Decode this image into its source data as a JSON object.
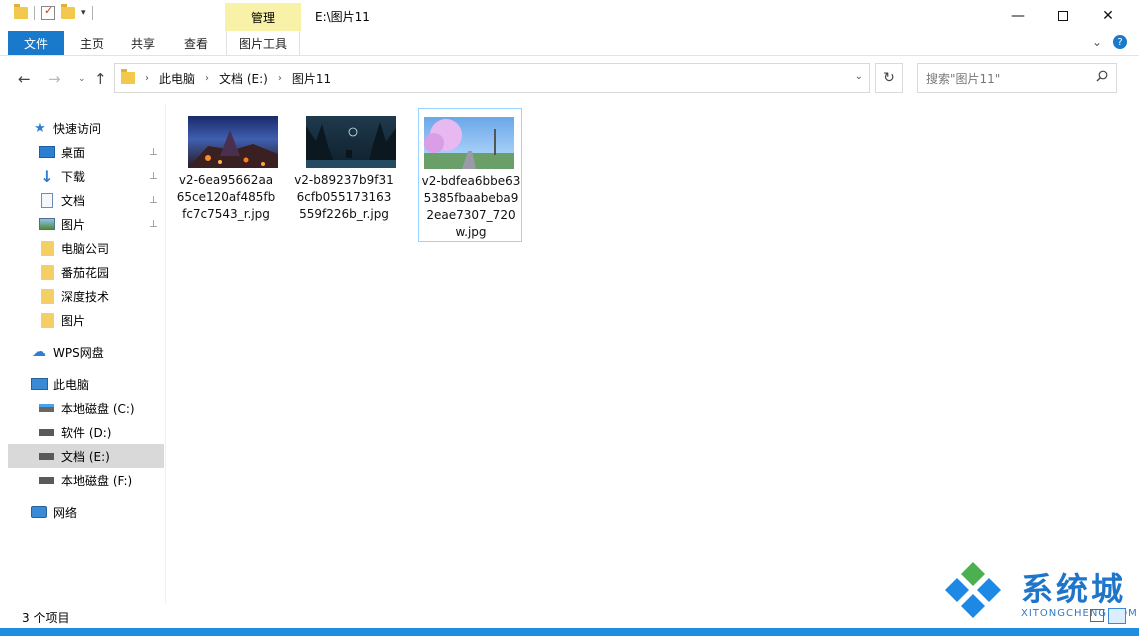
{
  "window": {
    "title": "E:\\图片11",
    "manage_tab": "管理",
    "controls": {
      "minimize": "—",
      "maximize": "",
      "close": "✕"
    }
  },
  "ribbon": {
    "tabs": [
      {
        "label": "文件"
      },
      {
        "label": "主页"
      },
      {
        "label": "共享"
      },
      {
        "label": "查看"
      },
      {
        "label": "图片工具"
      }
    ],
    "expand_glyph": "⌄",
    "help_glyph": "?"
  },
  "address": {
    "breadcrumbs": [
      "此电脑",
      "文档 (E:)",
      "图片11"
    ],
    "separator": "›",
    "search_placeholder": "搜索\"图片11\""
  },
  "sidebar": {
    "items": [
      {
        "label": "快速访问",
        "icon": "star-icon",
        "pinned": false
      },
      {
        "label": "桌面",
        "icon": "desktop-icon",
        "pinned": true
      },
      {
        "label": "下载",
        "icon": "download-icon",
        "pinned": true
      },
      {
        "label": "文档",
        "icon": "document-icon",
        "pinned": true
      },
      {
        "label": "图片",
        "icon": "picture-icon",
        "pinned": true
      },
      {
        "label": "电脑公司",
        "icon": "folder-icon",
        "pinned": false
      },
      {
        "label": "番茄花园",
        "icon": "folder-icon",
        "pinned": false
      },
      {
        "label": "深度技术",
        "icon": "folder-icon",
        "pinned": false
      },
      {
        "label": "图片",
        "icon": "folder-icon",
        "pinned": false
      },
      {
        "label": "WPS网盘",
        "icon": "cloud-icon",
        "pinned": false
      },
      {
        "label": "此电脑",
        "icon": "computer-icon",
        "pinned": false
      },
      {
        "label": "本地磁盘 (C:)",
        "icon": "drive-icon",
        "pinned": false
      },
      {
        "label": "软件 (D:)",
        "icon": "drive-icon",
        "pinned": false
      },
      {
        "label": "文档 (E:)",
        "icon": "drive-icon",
        "pinned": false,
        "selected": true
      },
      {
        "label": "本地磁盘 (F:)",
        "icon": "drive-icon",
        "pinned": false
      },
      {
        "label": "网络",
        "icon": "network-icon",
        "pinned": false
      }
    ],
    "pin_glyph": "📌"
  },
  "files": [
    {
      "name": "v2-6ea95662aa65ce120af485fbfc7c7543_r.jpg"
    },
    {
      "name": "v2-b89237b9f316cfb055173163559f226b_r.jpg"
    },
    {
      "name": "v2-bdfea6bbe635385fbaabeba92eae7307_720w.jpg",
      "selected": true
    }
  ],
  "status": {
    "count_text": "3 个项目"
  },
  "watermark": {
    "title": "系统城",
    "subtitle": "XITONGCHENG.COM"
  },
  "colors": {
    "accent": "#1979ca",
    "manage_tab_bg": "#f8f1a8",
    "selection": "#99d1ff"
  }
}
